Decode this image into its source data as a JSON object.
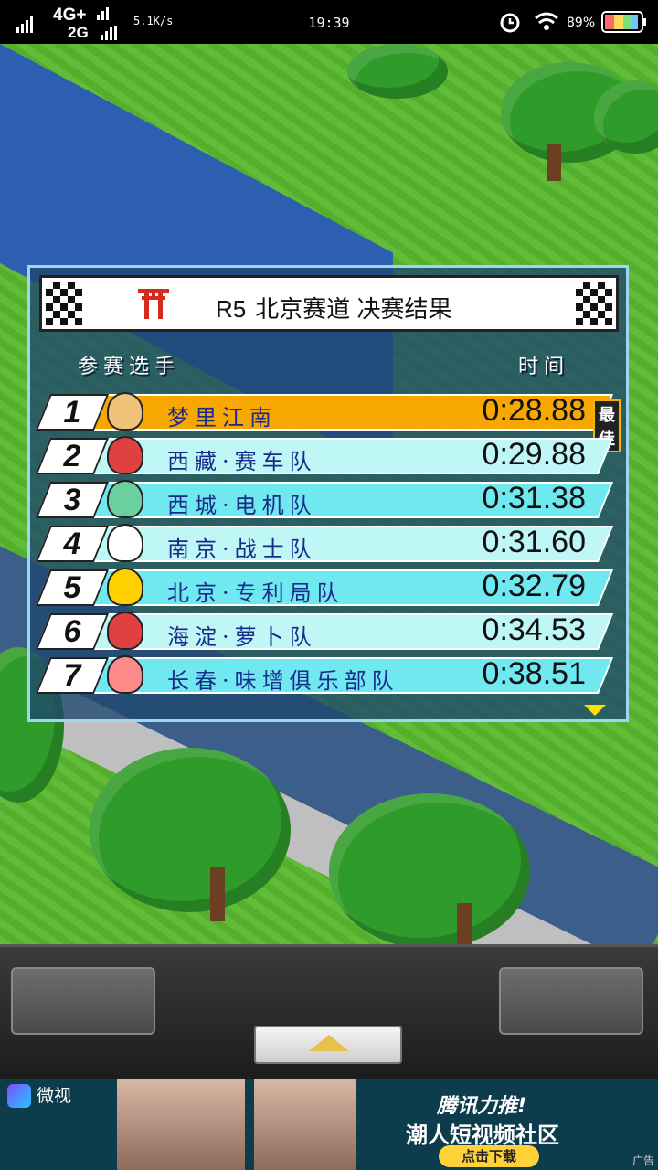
{
  "status_bar": {
    "network_1": "4G+",
    "network_2": "2G",
    "speed": "5.1K/s",
    "time": "19:39",
    "battery": "89%"
  },
  "panel": {
    "title_round": "R5",
    "title_text": "北京赛道 决赛结果",
    "col_players": "参赛选手",
    "col_time": "时间",
    "best_badge": "最佳",
    "rows": [
      {
        "rank": "1",
        "team": "梦里江南",
        "time": "0:28.88",
        "color": "#f7a800"
      },
      {
        "rank": "2",
        "team": "西藏·赛车队",
        "time": "0:29.88",
        "color": "#bff6f6"
      },
      {
        "rank": "3",
        "team": "西城·电机队",
        "time": "0:31.38",
        "color": "#6fe8f0"
      },
      {
        "rank": "4",
        "team": "南京·战士队",
        "time": "0:31.60",
        "color": "#bff6f6"
      },
      {
        "rank": "5",
        "team": "北京·专利局队",
        "time": "0:32.79",
        "color": "#6fe8f0"
      },
      {
        "rank": "6",
        "team": "海淀·萝卜队",
        "time": "0:34.53",
        "color": "#bff6f6"
      },
      {
        "rank": "7",
        "team": "长春·味增俱乐部队",
        "time": "0:38.51",
        "color": "#6fe8f0"
      }
    ]
  },
  "ad": {
    "brand": "微视",
    "headline": "腾讯力推!",
    "subline": "潮人短视频社区",
    "button": "点击下载",
    "label": "广告"
  }
}
